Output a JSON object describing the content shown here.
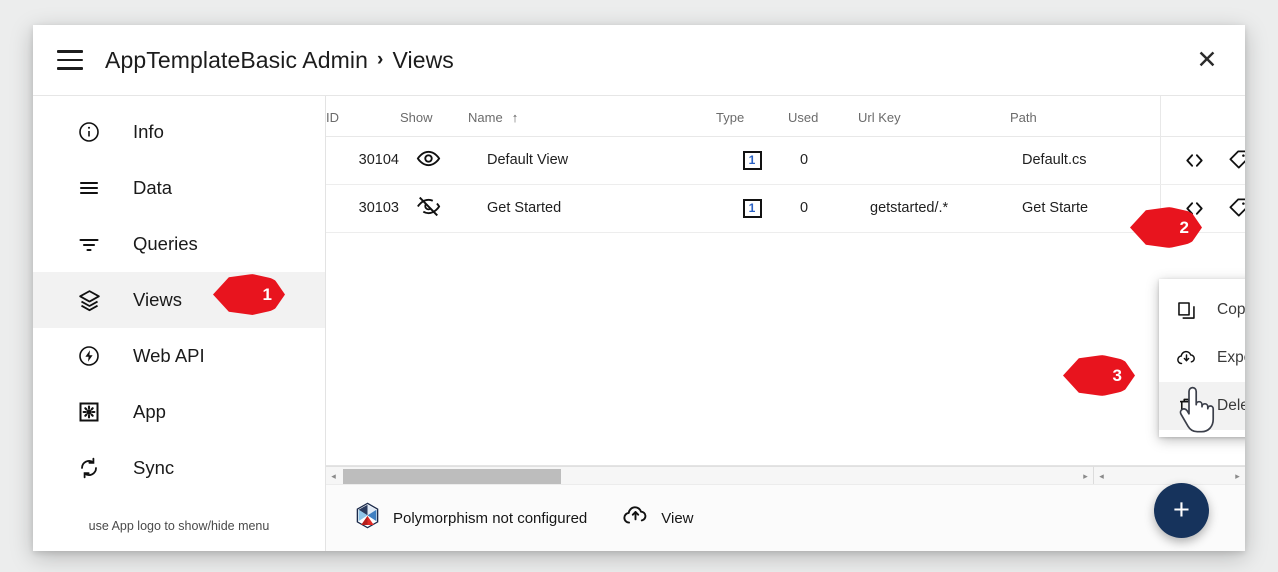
{
  "header": {
    "menu_icon": "hamburger-icon",
    "breadcrumb_app": "AppTemplateBasic Admin",
    "breadcrumb_sep": "›",
    "breadcrumb_page": "Views",
    "close_icon": "close-icon"
  },
  "sidebar": {
    "items": [
      {
        "label": "Info",
        "icon": "info-circle-icon",
        "active": false
      },
      {
        "label": "Data",
        "icon": "list-lines-icon",
        "active": false
      },
      {
        "label": "Queries",
        "icon": "filter-icon",
        "active": false
      },
      {
        "label": "Views",
        "icon": "layers-icon",
        "active": true
      },
      {
        "label": "Web API",
        "icon": "bolt-circle-icon",
        "active": false
      },
      {
        "label": "App",
        "icon": "gear-box-icon",
        "active": false
      },
      {
        "label": "Sync",
        "icon": "sync-icon",
        "active": false
      }
    ],
    "hint": "use App logo to show/hide menu"
  },
  "table": {
    "columns": [
      {
        "key": "id",
        "label": "ID"
      },
      {
        "key": "show",
        "label": "Show"
      },
      {
        "key": "name",
        "label": "Name",
        "sorted": true,
        "sort_arrow": "↑"
      },
      {
        "key": "type",
        "label": "Type"
      },
      {
        "key": "used",
        "label": "Used"
      },
      {
        "key": "url",
        "label": "Url Key"
      },
      {
        "key": "path",
        "label": "Path"
      },
      {
        "key": "actions",
        "label": ""
      }
    ],
    "rows": [
      {
        "id": "30104",
        "show_icon": "eye-visible-icon",
        "show_state": "visible",
        "name": "Default View",
        "type": "1",
        "used": "0",
        "url_key": "",
        "path": "Default.cshtml",
        "path_clipped": "Default.cs",
        "actions": [
          "code-icon",
          "tag-icon",
          "person-icon",
          "more-dots-icon"
        ]
      },
      {
        "id": "30103",
        "show_icon": "eye-hidden-icon",
        "show_state": "hidden",
        "name": "Get Started",
        "type": "1",
        "used": "0",
        "url_key": "getstarted/.*",
        "path": "Get Started.cshtml",
        "path_clipped": "Get Starte",
        "actions": [
          "code-icon",
          "tag-icon",
          "person-icon",
          "more-dots-icon"
        ]
      }
    ]
  },
  "context_menu": {
    "items": [
      {
        "label": "Copy",
        "icon": "copy-icon",
        "hover": false
      },
      {
        "label": "Export",
        "icon": "cloud-download-icon",
        "hover": false
      },
      {
        "label": "Delete",
        "icon": "trash-icon",
        "hover": true
      }
    ]
  },
  "footer": {
    "polymorphism_label": "Polymorphism not configured",
    "polymorphism_icon": "polymorphism-logo",
    "view_label": "View",
    "view_icon": "cloud-upload-icon",
    "add_label": "+"
  },
  "callouts": [
    {
      "number": "1",
      "target": "sidebar-item-views"
    },
    {
      "number": "2",
      "target": "row-more-dots"
    },
    {
      "number": "3",
      "target": "menu-delete"
    }
  ],
  "colors": {
    "callout_red": "#e8141e",
    "fab_navy": "#16335c",
    "active_row": "#f2f2f2",
    "type_badge_number": "#2b62c4"
  },
  "scrollbars": {
    "left_arrow": "◂",
    "right_arrow": "▸"
  }
}
